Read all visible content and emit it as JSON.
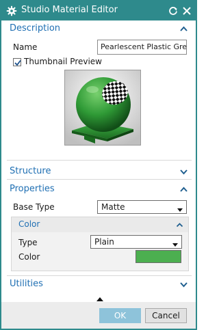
{
  "window": {
    "title": "Studio Material Editor"
  },
  "description": {
    "header": "Description",
    "name_label": "Name",
    "name_value": "Pearlescent Plastic Green",
    "thumbnail_preview_label": "Thumbnail Preview",
    "thumbnail_preview_checked": true
  },
  "structure": {
    "header": "Structure"
  },
  "properties": {
    "header": "Properties",
    "base_type_label": "Base Type",
    "base_type_value": "Matte",
    "color_panel": {
      "header": "Color",
      "type_label": "Type",
      "type_value": "Plain",
      "color_label": "Color",
      "color_value": "#4caf50"
    }
  },
  "utilities": {
    "header": "Utilities"
  },
  "buttons": {
    "ok": "OK",
    "cancel": "Cancel"
  },
  "colors": {
    "title_bar": "#2e8a8c",
    "section_header_text": "#1f6fb3",
    "ok_button": "#8ec3da"
  },
  "icons": {
    "title": "gear-icon",
    "reset": "reset-icon",
    "close": "close-icon",
    "expanded": "chevron-up-icon",
    "collapsed": "chevron-down-icon"
  }
}
